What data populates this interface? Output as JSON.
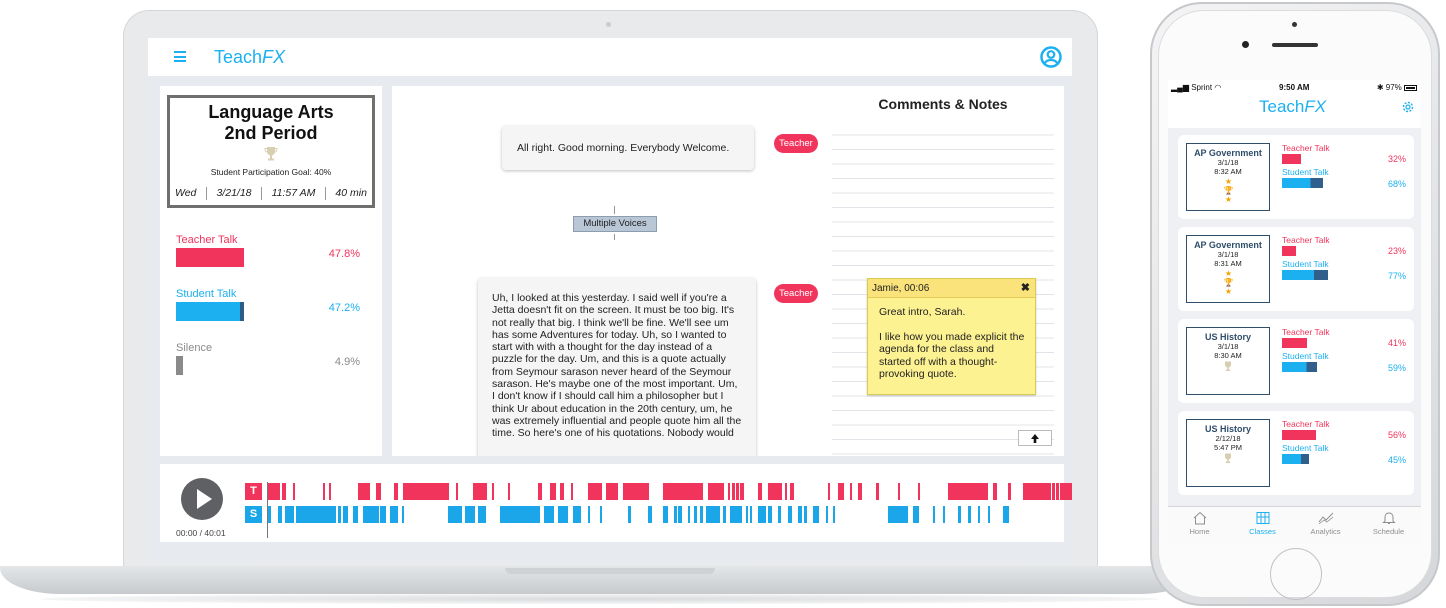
{
  "app": {
    "brand_prefix": "Teach",
    "brand_suffix": "FX"
  },
  "class_card": {
    "title_line1": "Language Arts",
    "title_line2": "2nd Period",
    "goal": "Student Participation Goal: 40%",
    "day": "Wed",
    "date": "3/21/18",
    "time": "11:57 AM",
    "duration": "40 min"
  },
  "stats": [
    {
      "label": "Teacher Talk",
      "value": "47.8%",
      "color": "#f1345c"
    },
    {
      "label": "Student Talk",
      "value": "47.2%",
      "color": "#1cb0f0"
    },
    {
      "label": "Silence",
      "value": "4.9%",
      "color": "#8a8a8a"
    }
  ],
  "transcript": {
    "bubble1": "All right. Good morning. Everybody Welcome.",
    "speaker1": "Teacher",
    "multiple_voices": "Multiple Voices",
    "bubble2": "Uh, I looked at this yesterday. I said well if you're a Jetta doesn't fit on the screen. It must be too big. It's not really that big. I think we'll be fine. We'll see um has some Adventures for today. Uh, so I wanted to start with with a thought for the day instead of a puzzle for the day. Um, and this is a quote actually from Seymour sarason never heard of the Seymour sarason. He's maybe one of the most important. Um, I don't know if I should call him a philosopher but I think Ur about education in the 20th century, um, he was extremely influential and people quote him all the time. So here's one of his quotations. Nobody would",
    "speaker2": "Teacher"
  },
  "notes": {
    "heading": "Comments & Notes",
    "sticky_header": "Jamie, 00:06",
    "sticky_close": "✖",
    "sticky_line1": "Great intro, Sarah.",
    "sticky_line2": "I like how you made explicit the agenda for the class and started off with a thought-provoking quote.",
    "scroll_up": "🡑"
  },
  "player": {
    "time": "00:00 / 40:01",
    "teacher_badge": "T",
    "student_badge": "S",
    "teacher_color": "#f1345c",
    "student_color": "#1aa6e8"
  },
  "phone": {
    "carrier": "Sprint",
    "clock": "9:50 AM",
    "battery": "97%",
    "brand_prefix": "Teach",
    "brand_suffix": "FX",
    "cards": [
      {
        "title": "AP Government",
        "date": "3/1/18",
        "time": "8:32 AM",
        "teacher_label": "Teacher Talk",
        "teacher_pct": "32%",
        "student_label": "Student Talk",
        "student_pct": "68%",
        "teacher_fraction": 0.32,
        "student_fraction": 0.68,
        "gold": true
      },
      {
        "title": "AP Government",
        "date": "3/1/18",
        "time": "8:31 AM",
        "teacher_label": "Teacher Talk",
        "teacher_pct": "23%",
        "student_label": "Student Talk",
        "student_pct": "77%",
        "teacher_fraction": 0.23,
        "student_fraction": 0.77,
        "gold": true
      },
      {
        "title": "US History",
        "date": "3/1/18",
        "time": "8:30 AM",
        "teacher_label": "Teacher Talk",
        "teacher_pct": "41%",
        "student_label": "Student Talk",
        "student_pct": "59%",
        "teacher_fraction": 0.41,
        "student_fraction": 0.59,
        "gold": false
      },
      {
        "title": "US History",
        "date": "2/12/18",
        "time": "5:47 PM",
        "teacher_label": "Teacher Talk",
        "teacher_pct": "56%",
        "student_label": "Student Talk",
        "student_pct": "45%",
        "teacher_fraction": 0.56,
        "student_fraction": 0.45,
        "gold": false
      }
    ],
    "tabs": [
      "Home",
      "Classes",
      "Analytics",
      "Schedule"
    ],
    "active_tab": "Classes"
  }
}
